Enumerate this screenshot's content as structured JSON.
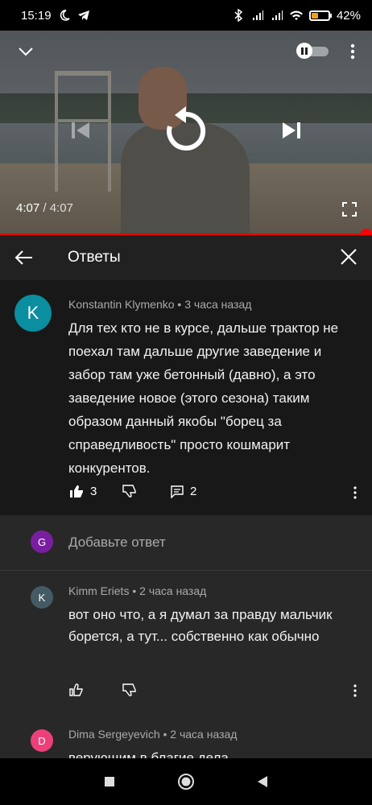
{
  "status_bar": {
    "time": "15:19",
    "battery_percent": "42%",
    "battery_level": 0.42,
    "icons": [
      "moon-icon",
      "telegram-icon",
      "bluetooth-icon",
      "signal-icon",
      "signal-icon",
      "wifi-icon",
      "battery-icon"
    ]
  },
  "player": {
    "current_time": "4:07",
    "separator": "/",
    "duration": "4:07",
    "progress": 1.0,
    "icons": [
      "chevron-down-icon",
      "pause-toggle-icon",
      "more-vert-icon",
      "previous-icon",
      "replay-icon",
      "next-icon",
      "fullscreen-icon"
    ]
  },
  "replies_panel": {
    "title": "Ответы",
    "parent_comment": {
      "avatar_letter": "K",
      "author": "Konstantin Klymenko",
      "time": "3 часа назад",
      "text": "Для тех кто не в курсе, дальше трактор не поехал там дальше другие заведение и забор там уже бетонный (давно), а это заведение новое (этого сезона) таким образом данный якобы \"борец за справедливость\" просто кошмарит конкурентов.",
      "likes": "3",
      "replies": "2"
    },
    "add_reply": {
      "avatar_letter": "G",
      "placeholder": "Добавьте ответ"
    },
    "replies": [
      {
        "avatar_letter": "K",
        "author": "Kimm Eriets",
        "time": "2 часа назад",
        "text": "вот оно что, а я думал за правду мальчик борется, а тут...  собственно как обычно"
      },
      {
        "avatar_letter": "D",
        "author": "Dima Sergeyevich",
        "time": "2 часа назад",
        "text": "верующим в благие дела"
      }
    ],
    "separator": "•",
    "colors": {
      "accent": "#ff0000",
      "panel_bg": "#282828",
      "parent_bg": "#181818",
      "avatar_k": "#0a8ea0",
      "avatar_g": "#7a1ea1",
      "avatar_k2": "#455a64",
      "avatar_d": "#ec407a"
    }
  },
  "nav_bar": {
    "icons": [
      "recents-icon",
      "home-icon",
      "back-icon"
    ]
  }
}
